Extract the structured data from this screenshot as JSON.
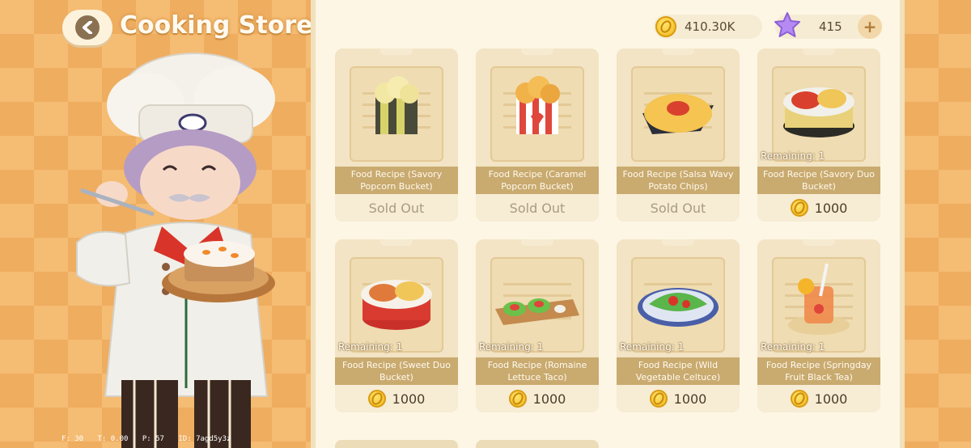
{
  "header": {
    "title": "Cooking Store"
  },
  "currency": {
    "coins": "410.30K",
    "stars": "415",
    "coin_icon": "coin-icon",
    "star_icon": "star-icon",
    "plus_label": "+"
  },
  "debug": {
    "f": "F: 30",
    "t": "T: 0.00",
    "p": "P: 57",
    "id": "ID: 7agd5y3z"
  },
  "cards": [
    {
      "name": "Food Recipe (Savory Popcorn Bucket)",
      "remaining": "",
      "status": "Sold Out",
      "price": "",
      "art": "popcorn-yellow"
    },
    {
      "name": "Food Recipe (Caramel Popcorn Bucket)",
      "remaining": "",
      "status": "Sold Out",
      "price": "",
      "art": "popcorn-red"
    },
    {
      "name": "Food Recipe (Salsa Wavy Potato Chips)",
      "remaining": "",
      "status": "Sold Out",
      "price": "",
      "art": "chips"
    },
    {
      "name": "Food Recipe (Savory Duo Bucket)",
      "remaining": "Remaining: 1",
      "status": "",
      "price": "1000",
      "art": "duo-dark"
    },
    {
      "name": "Food Recipe (Sweet Duo Bucket)",
      "remaining": "Remaining: 1",
      "status": "",
      "price": "1000",
      "art": "duo-red"
    },
    {
      "name": "Food Recipe (Romaine Lettuce Taco)",
      "remaining": "Remaining: 1",
      "status": "",
      "price": "1000",
      "art": "taco"
    },
    {
      "name": "Food Recipe (Wild Vegetable Celtuce)",
      "remaining": "Remaining: 1",
      "status": "",
      "price": "1000",
      "art": "celtuce"
    },
    {
      "name": "Food Recipe (Springday Fruit Black Tea)",
      "remaining": "Remaining: 1",
      "status": "",
      "price": "1000",
      "art": "tea"
    }
  ],
  "colors": {
    "background": "#f6bd74",
    "panel": "#fdf6e4",
    "card_label": "#c9aa6f",
    "coin": "#f0b81e",
    "star": "#a77cf0"
  }
}
